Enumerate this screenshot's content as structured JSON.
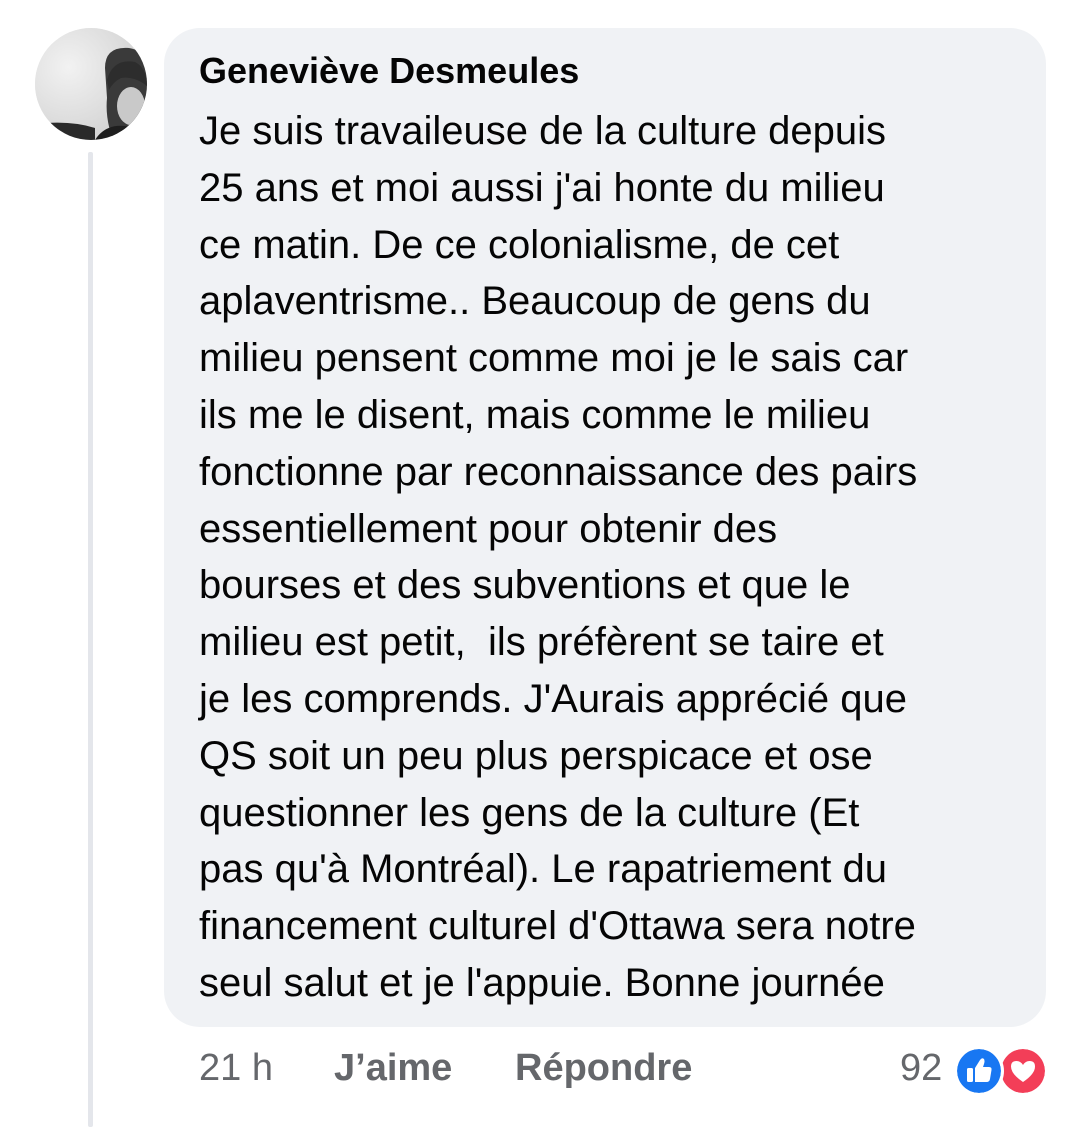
{
  "comment": {
    "author": "Geneviève Desmeules",
    "text_lines": [
      "Je suis travaileuse de la culture depuis",
      "25 ans et moi aussi j'ai honte du milieu",
      "ce matin. De ce colonialisme, de cet",
      "aplaventrisme.. Beaucoup de gens du",
      "milieu pensent comme moi je le sais car",
      "ils me le disent, mais comme le milieu",
      "fonctionne par reconnaissance des pairs",
      "essentiellement pour obtenir des",
      "bourses et des subventions et que le",
      "milieu est petit,  ils préfèrent se taire et",
      "je les comprends. J'Aurais apprécié que",
      "QS soit un peu plus perspicace et ose",
      "questionner les gens de la culture (Et",
      "pas qu'à Montréal). Le rapatriement du",
      "financement culturel d'Ottawa sera notre",
      "seul salut et je l'appuie. Bonne journée"
    ]
  },
  "footer": {
    "timestamp": "21 h",
    "like_label": "J’aime",
    "reply_label": "Répondre",
    "reaction_count": "92"
  },
  "reactions": [
    "like-icon",
    "love-icon"
  ],
  "colors": {
    "bubble_bg": "#f0f2f5",
    "text": "#050505",
    "secondary_text": "#65676b",
    "like_blue": "#1877f2",
    "love_red": "#f33e58"
  }
}
